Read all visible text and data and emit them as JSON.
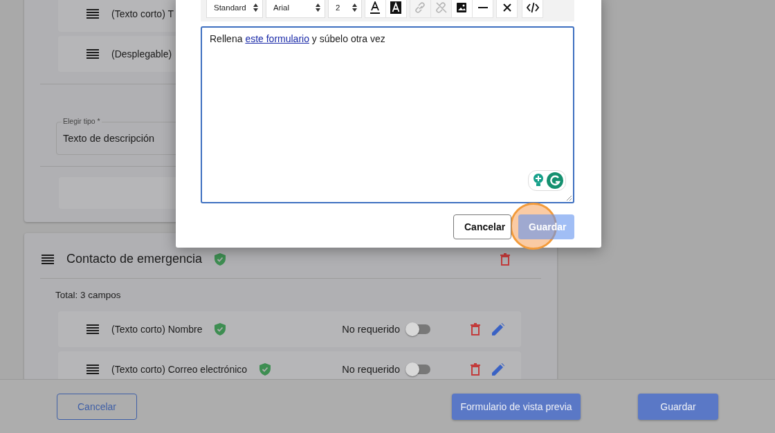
{
  "background": {
    "top_fields": [
      {
        "label": "(Texto corto) T"
      },
      {
        "label": "(Desplegable)"
      }
    ],
    "type_select": {
      "label": "Elegir tipo *",
      "value": "Texto de descripción"
    },
    "section": {
      "title": "Contacto de emergencia",
      "total": "Total: 3 campos",
      "fields": [
        {
          "label": "(Texto corto) Nombre",
          "required_label": "No requerido",
          "on": false
        },
        {
          "label": "(Texto corto) Correo electrónico",
          "required_label": "No requerido",
          "on": false
        }
      ]
    }
  },
  "modal": {
    "toolbar": [
      {
        "kind": "select",
        "value": "Standard"
      },
      {
        "kind": "select",
        "value": "Arial"
      },
      {
        "kind": "select",
        "value": "2"
      },
      {
        "kind": "fontcolor",
        "disabled": false
      },
      {
        "kind": "highlight",
        "disabled": false
      },
      {
        "kind": "link",
        "disabled": true
      },
      {
        "kind": "unlink",
        "disabled": true
      },
      {
        "kind": "image",
        "disabled": false
      },
      {
        "kind": "rule",
        "disabled": false
      },
      {
        "kind": "clear",
        "disabled": false
      },
      {
        "kind": "code",
        "disabled": false
      }
    ],
    "editor": {
      "text_before": "Rellena ",
      "link": "este formulario",
      "text_after": " y súbelo otra vez"
    },
    "buttons": [
      {
        "label": "Cancelar",
        "kind": "secondary"
      },
      {
        "label": "Guardar",
        "kind": "primary"
      }
    ]
  },
  "footer": {
    "buttons": [
      {
        "label": "Cancelar",
        "kind": "outline"
      },
      {
        "label": "Formulario de vista previa",
        "kind": "primary"
      },
      {
        "label": "Guardar",
        "kind": "primary"
      }
    ]
  }
}
